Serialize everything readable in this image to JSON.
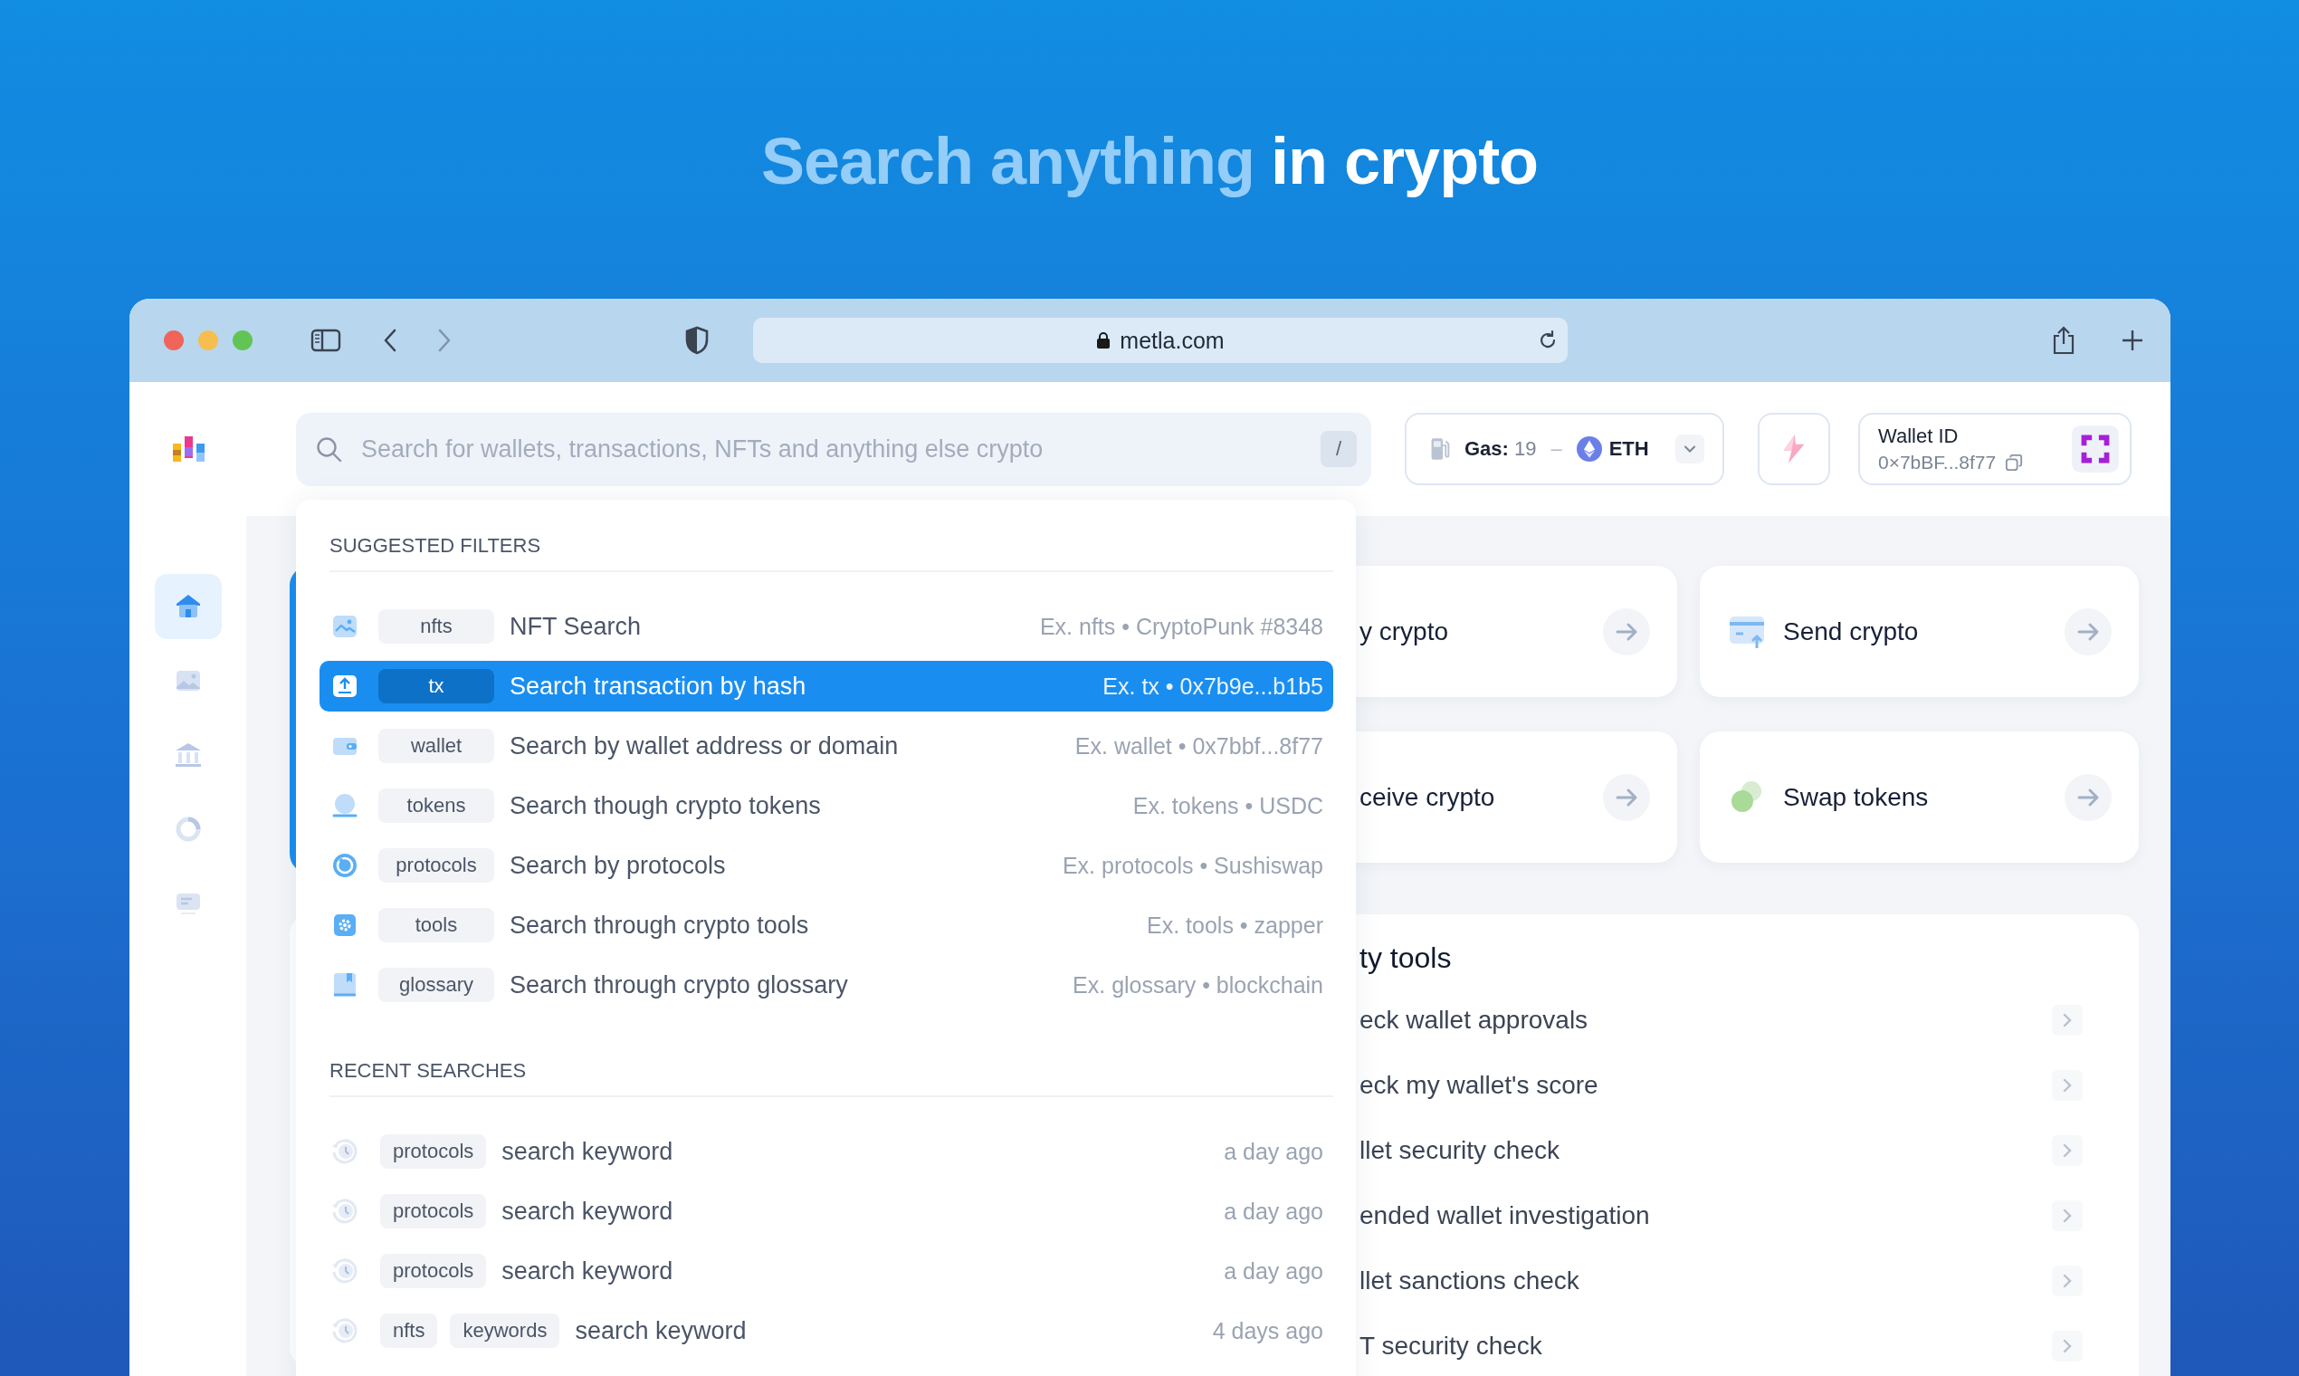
{
  "headline": {
    "highlight": "Search anything",
    "rest": "in crypto"
  },
  "browser": {
    "url": "metla.com"
  },
  "search": {
    "placeholder": "Search for wallets, transactions, NFTs and anything else crypto",
    "shortcut": "/"
  },
  "gas": {
    "label": "Gas:",
    "value": "19",
    "separator": "–",
    "network": "ETH"
  },
  "wallet": {
    "label": "Wallet ID",
    "address": "0×7bBF...8f77"
  },
  "sidebar": {
    "items": [
      {
        "kind": "home",
        "selected": true
      },
      {
        "kind": "image",
        "selected": false
      },
      {
        "kind": "bank",
        "selected": false
      },
      {
        "kind": "chart",
        "selected": false
      },
      {
        "kind": "document",
        "selected": false
      }
    ]
  },
  "suggested_filters": {
    "title": "SUGGESTED FILTERS",
    "items": [
      {
        "kind": "nft",
        "tag": "nfts",
        "label": "NFT Search",
        "example": "Ex. nfts • CryptoPunk #8348",
        "selected": false
      },
      {
        "kind": "tx",
        "tag": "tx",
        "label": "Search transaction by hash",
        "example": "Ex. tx • 0x7b9e...b1b5",
        "selected": true
      },
      {
        "kind": "wallet",
        "tag": "wallet",
        "label": "Search by wallet address or domain",
        "example": "Ex. wallet • 0x7bbf...8f77",
        "selected": false
      },
      {
        "kind": "token",
        "tag": "tokens",
        "label": "Search though crypto tokens",
        "example": "Ex. tokens • USDC",
        "selected": false
      },
      {
        "kind": "protocol",
        "tag": "protocols",
        "label": "Search by protocols",
        "example": "Ex. protocols • Sushiswap",
        "selected": false
      },
      {
        "kind": "tool",
        "tag": "tools",
        "label": "Search through crypto tools",
        "example": "Ex. tools • zapper",
        "selected": false
      },
      {
        "kind": "glossary",
        "tag": "glossary",
        "label": "Search through crypto glossary",
        "example": "Ex. glossary • blockchain",
        "selected": false
      }
    ]
  },
  "recent_searches": {
    "title": "RECENT SEARCHES",
    "items": [
      {
        "tags": [
          "protocols"
        ],
        "query": "search keyword",
        "time": "a day ago"
      },
      {
        "tags": [
          "protocols"
        ],
        "query": "search keyword",
        "time": "a day ago"
      },
      {
        "tags": [
          "protocols"
        ],
        "query": "search keyword",
        "time": "a day ago"
      },
      {
        "tags": [
          "nfts",
          "keywords"
        ],
        "query": "search keyword",
        "time": "4 days ago"
      }
    ]
  },
  "actions": [
    {
      "kind": "none",
      "label": "y crypto"
    },
    {
      "kind": "send",
      "label": "Send crypto"
    },
    {
      "kind": "none",
      "label": "ceive crypto"
    },
    {
      "kind": "swap",
      "label": "Swap tokens"
    }
  ],
  "tools": {
    "title": "ty tools",
    "items": [
      "eck wallet approvals",
      "eck my wallet's score",
      "llet security check",
      "ended wallet investigation",
      "llet sanctions check",
      "T security check"
    ]
  }
}
